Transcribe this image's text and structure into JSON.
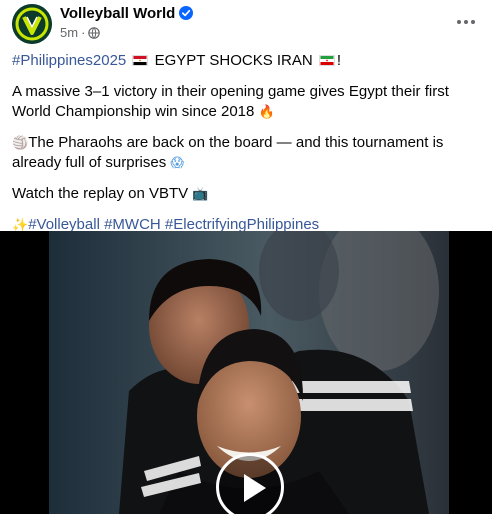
{
  "post": {
    "page_name": "Volleyball World",
    "timestamp": "5m",
    "separator": "·",
    "line1_hashtag": "#Philippines2025",
    "line1_text": "EGYPT SHOCKS IRAN",
    "line1_end": "!",
    "paragraph2": "A massive 3–1 victory in their opening game gives Egypt their first World Championship win since 2018",
    "paragraph2_emoji": "🔥",
    "paragraph3_emoji": "🏐",
    "paragraph3": "The Pharaohs are back on the board — and this tournament is already full of surprises",
    "paragraph3_end_emoji": "😱",
    "paragraph4": "Watch the replay on VBTV",
    "paragraph4_emoji": "📺",
    "sparkle_emoji": "✨",
    "hashtags": [
      "#Volleyball",
      "#MWCH",
      "#ElectrifyingPhilippines"
    ]
  },
  "icons": {
    "avatar": "volleyball-world-logo",
    "verified": "verified-badge-icon",
    "privacy": "globe-icon",
    "more": "more-options-icon",
    "play": "play-icon"
  },
  "colors": {
    "hashtag": "#385898",
    "meta": "#65676b",
    "verified": "#0866ff",
    "avatar_bg": "#0c3b2a",
    "avatar_ring": "#c8e600"
  }
}
